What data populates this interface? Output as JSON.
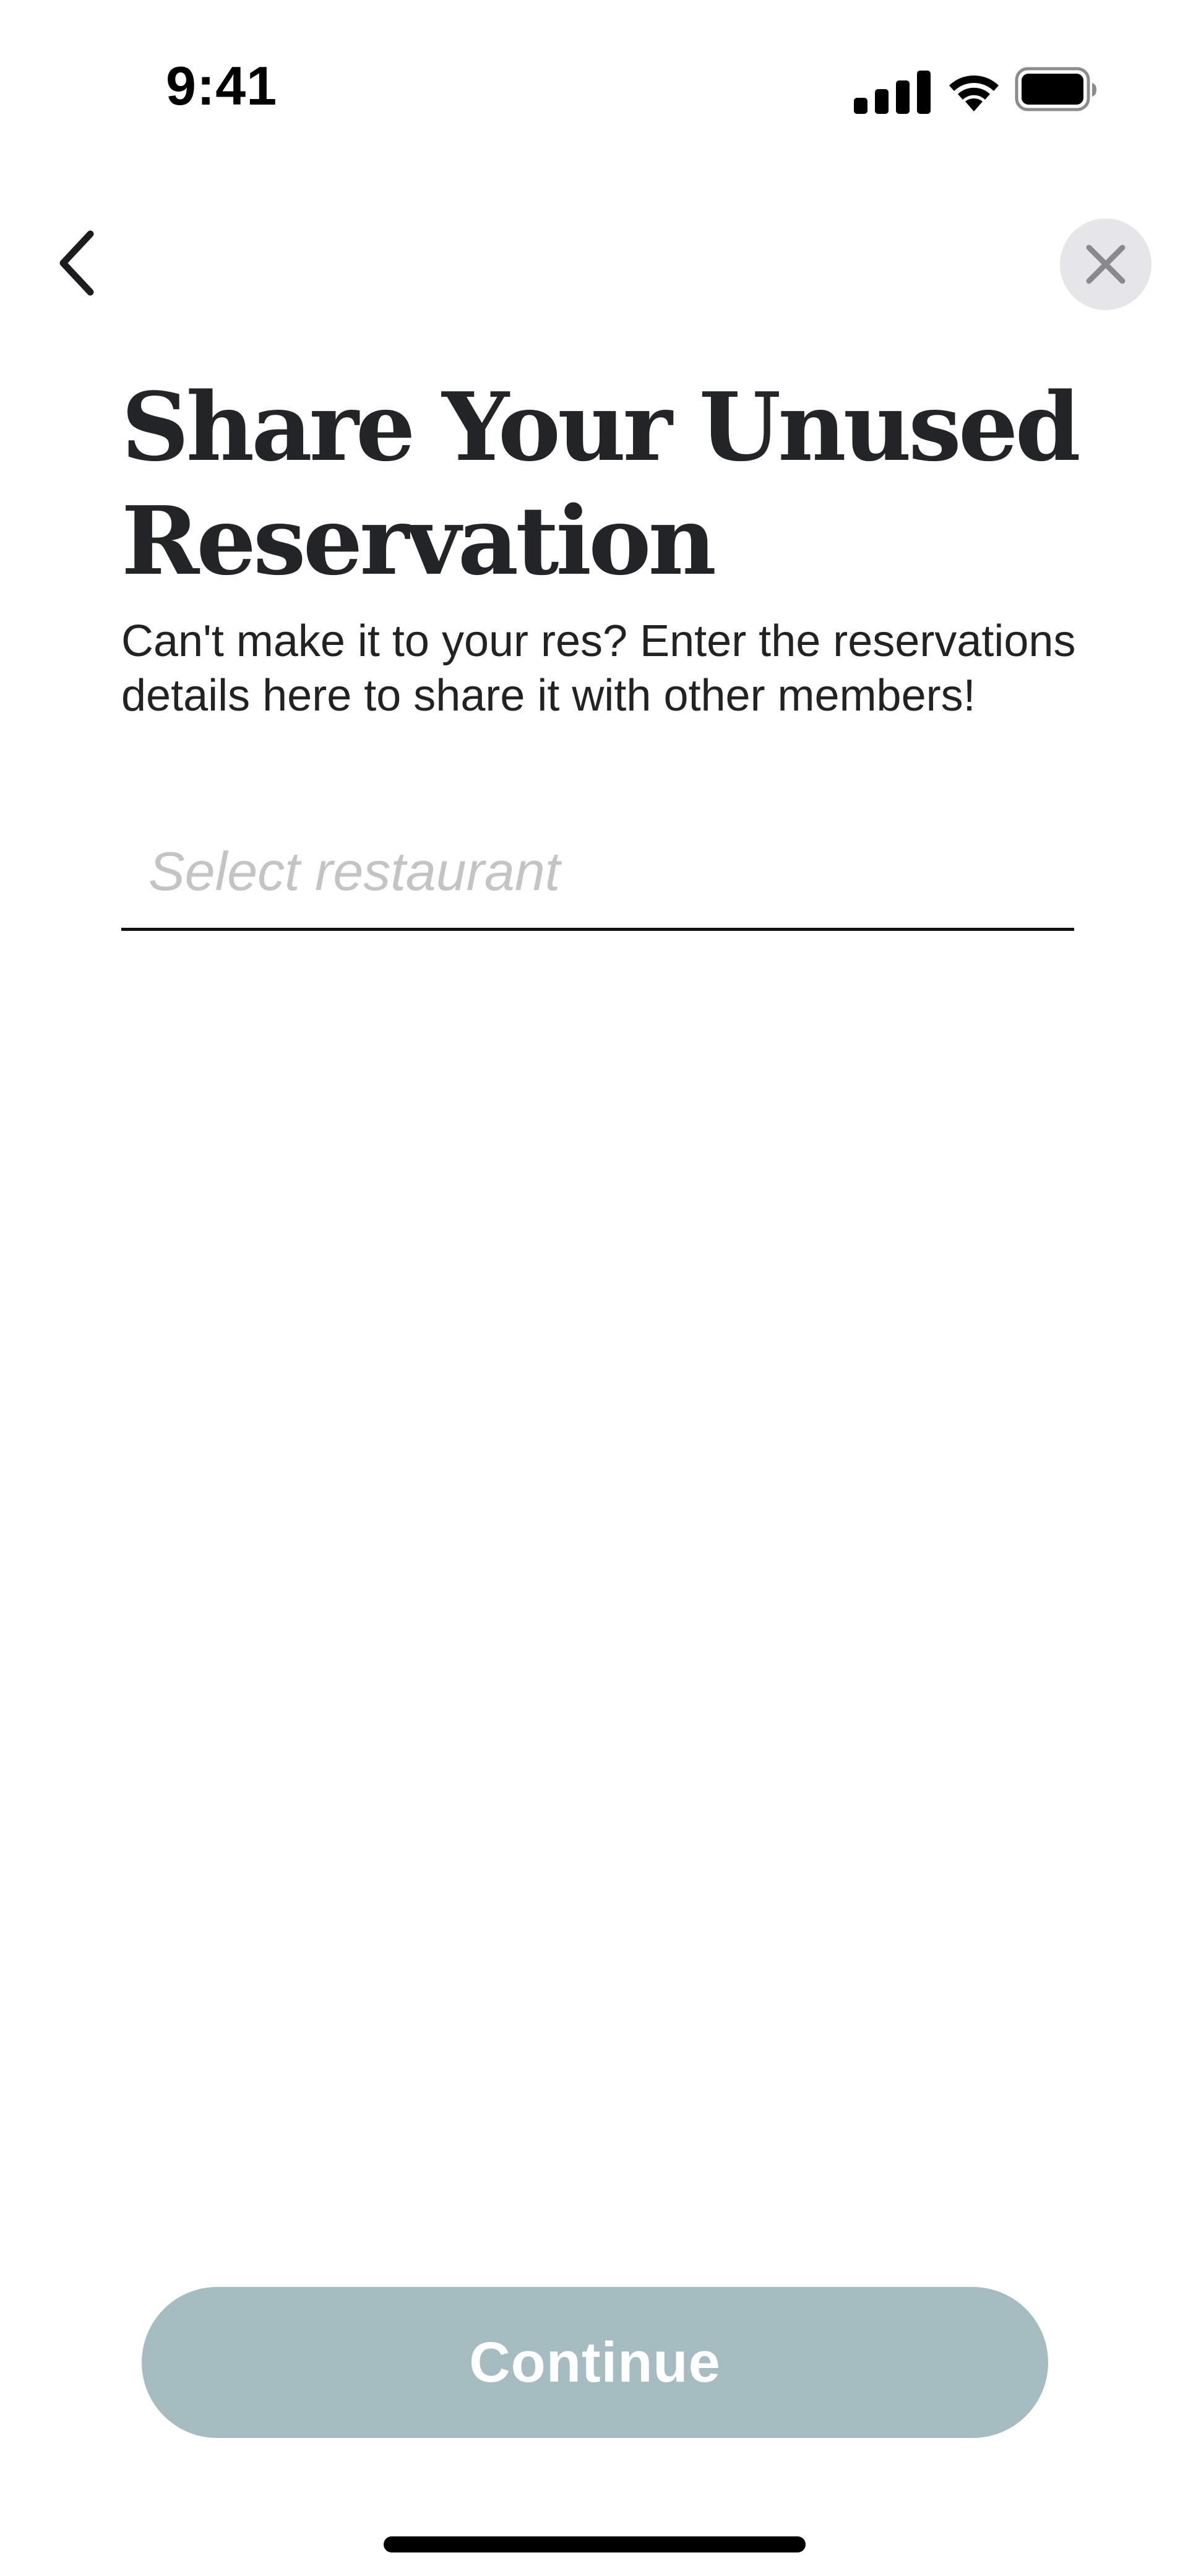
{
  "status_bar": {
    "time": "9:41",
    "icons": [
      "cellular-signal-icon",
      "wifi-icon",
      "battery-icon"
    ]
  },
  "nav": {
    "back_icon": "chevron-left-icon",
    "close_icon": "close-icon"
  },
  "header": {
    "title": "Share Your Unused Reservation",
    "subtitle": "Can't make it to your res? Enter the reservations details here to share it with other members!"
  },
  "form": {
    "restaurant": {
      "value": "",
      "placeholder": "Select restaurant"
    }
  },
  "footer": {
    "continue_label": "Continue",
    "continue_enabled": false
  },
  "colors": {
    "button_disabled": "#a5bcc1",
    "title": "#232427",
    "placeholder": "#c4c4c6",
    "close_bg": "#e6e6e8"
  }
}
